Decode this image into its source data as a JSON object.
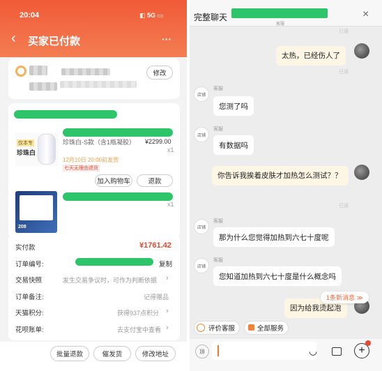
{
  "left": {
    "status_time": "20:04",
    "status_icons": "◧ 5G ▭",
    "back_glyph": "‹",
    "title": "买家已付款",
    "more_glyph": "···",
    "modify_address": "修改",
    "product1": {
      "badge_line1": "仅本专",
      "badge_line2": "珍珠白",
      "name": "珍珠白-S款（含1瓶凝胶）",
      "price": "¥2299.00",
      "qty": "x1",
      "ship_note": "12月10日 20:00前发货",
      "tag": "七天无理由退货",
      "btn_cart": "加入购物车",
      "btn_refund": "退款"
    },
    "product2": {
      "qty": "x1",
      "thumb_num": "208"
    },
    "paid_label": "实付款",
    "paid_amount": "¥1761.42",
    "rows": [
      {
        "label": "订单编号:",
        "value": "",
        "action": "复制"
      },
      {
        "label": "交易快照",
        "value": "发生交易争议时，可作为判断依据",
        "action": "›"
      },
      {
        "label": "订单备注:",
        "value": "记得赠品",
        "action": ""
      },
      {
        "label": "天猫积分:",
        "value": "获得937点积分",
        "action": "›"
      },
      {
        "label": "花呗账单:",
        "value": "去支付宝中查看",
        "action": "›"
      }
    ],
    "bottom_buttons": [
      "批量退款",
      "催发货",
      "修改地址"
    ]
  },
  "right": {
    "title": "完整聊天",
    "subtitle": "客服",
    "close": "×",
    "read": "已读",
    "sender": "客服",
    "avatar_text": "店铺",
    "messages": [
      {
        "side": "right",
        "text": "太热，已经伤人了"
      },
      {
        "side": "left",
        "text": "您测了吗"
      },
      {
        "side": "left",
        "text": "有数据吗"
      },
      {
        "side": "right",
        "text": "你告诉我挨着皮肤才加热怎么测试？？"
      },
      {
        "side": "left",
        "text": "那为什么您觉得加热到六七十度呢"
      },
      {
        "side": "left",
        "text": "您知道加热到六七十度是什么概念吗"
      },
      {
        "side": "right",
        "text": "因为给我烫起泡"
      }
    ],
    "new_msg": "1条新消息 ≫",
    "quick": [
      "评价客服",
      "全部服务"
    ],
    "voice_icon": ")))",
    "emoji_icon": "◡",
    "plus": "+"
  }
}
